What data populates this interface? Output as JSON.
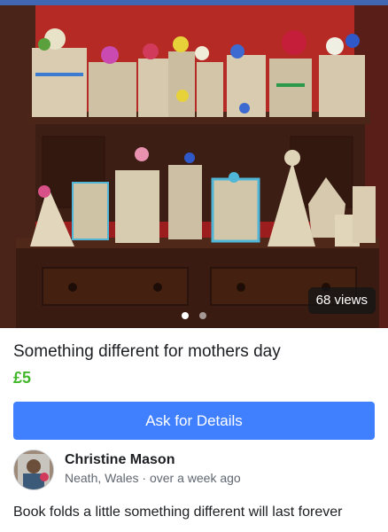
{
  "listing": {
    "views_label": "68 views",
    "title": "Something different for mothers day",
    "price": "£5",
    "photo_count": 2,
    "active_photo": 1,
    "accent_color": "#4080ff",
    "price_color": "#42b72a"
  },
  "actions": {
    "ask_label": "Ask for Details"
  },
  "seller": {
    "name": "Christine Mason",
    "location": "Neath, Wales",
    "time": "over a week ago"
  },
  "description": "Book folds a little something different will last forever"
}
